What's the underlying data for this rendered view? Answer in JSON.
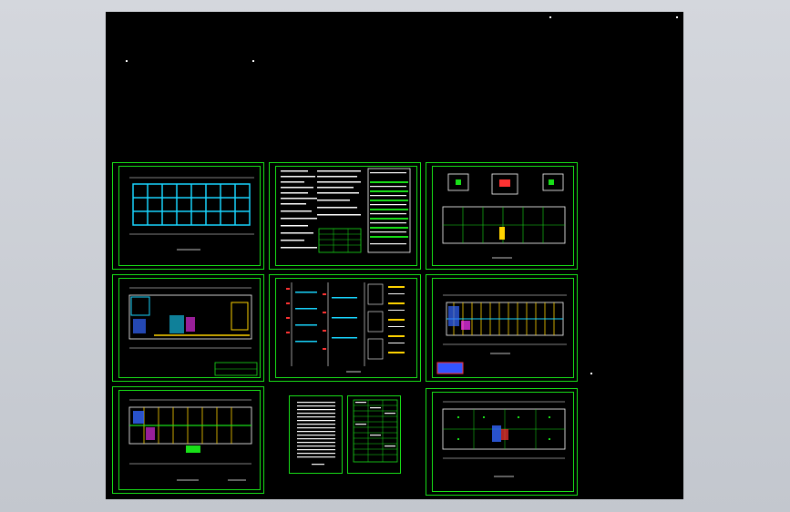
{
  "viewer": {
    "canvas_background": "#000000",
    "frame_color": "#18e018",
    "accent_colors": [
      "#18e018",
      "#19d6ff",
      "#ffd400",
      "#ff3333",
      "#3366ff",
      "#ff33ff",
      "#ffffff"
    ]
  },
  "sheets": [
    {
      "id": "floor-plan-1",
      "kind": "plan"
    },
    {
      "id": "notes-sheet",
      "kind": "notes"
    },
    {
      "id": "details-plan",
      "kind": "details"
    },
    {
      "id": "floor-plan-2",
      "kind": "plan"
    },
    {
      "id": "schematic-sheet",
      "kind": "schematic"
    },
    {
      "id": "floor-plan-3",
      "kind": "plan"
    },
    {
      "id": "floor-plan-4",
      "kind": "plan"
    },
    {
      "id": "tables-sheet",
      "kind": "tables"
    },
    {
      "id": "floor-plan-5",
      "kind": "plan"
    }
  ]
}
